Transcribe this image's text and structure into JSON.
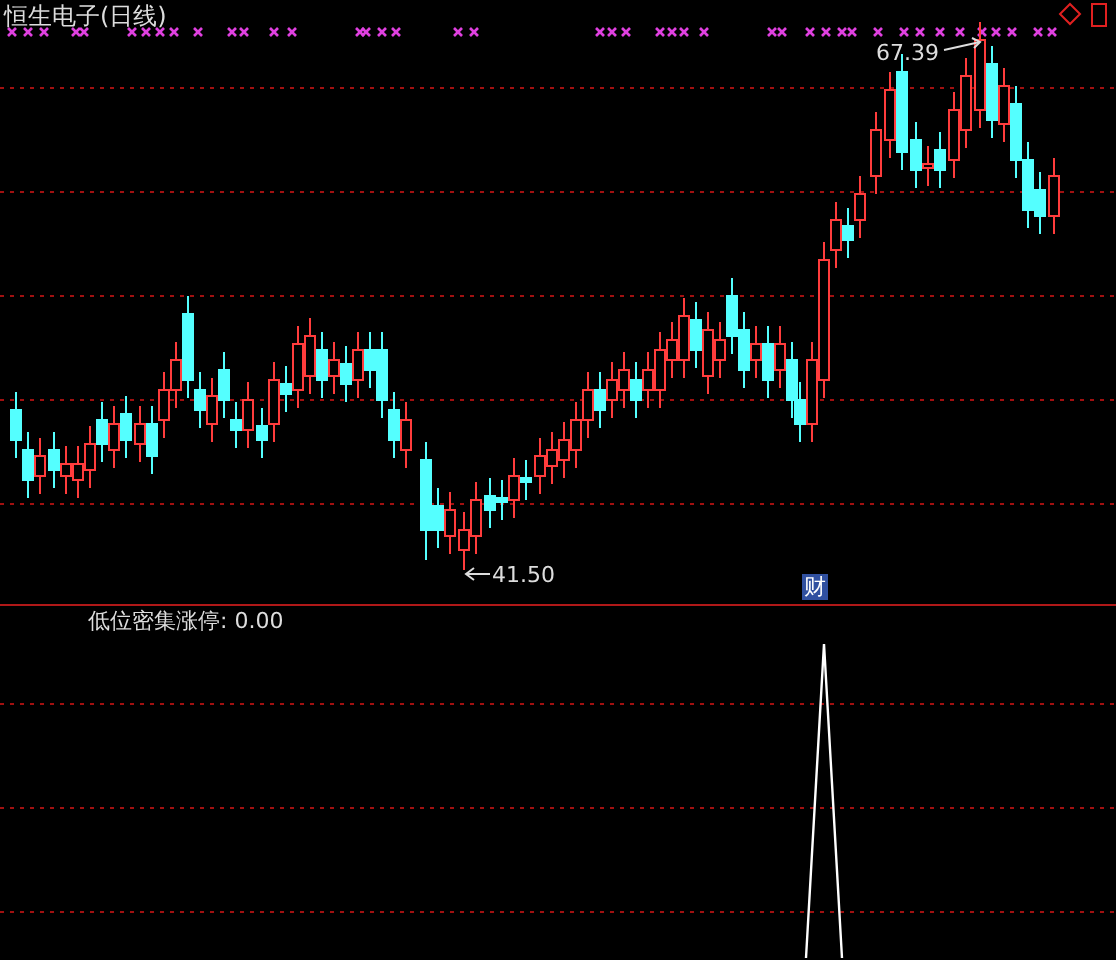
{
  "chart": {
    "title": "恒生电子(日线)",
    "high_label": "67.39",
    "low_label": "41.50",
    "event_badge": "财"
  },
  "indicator": {
    "label": "低位密集涨停: 0.00"
  }
}
